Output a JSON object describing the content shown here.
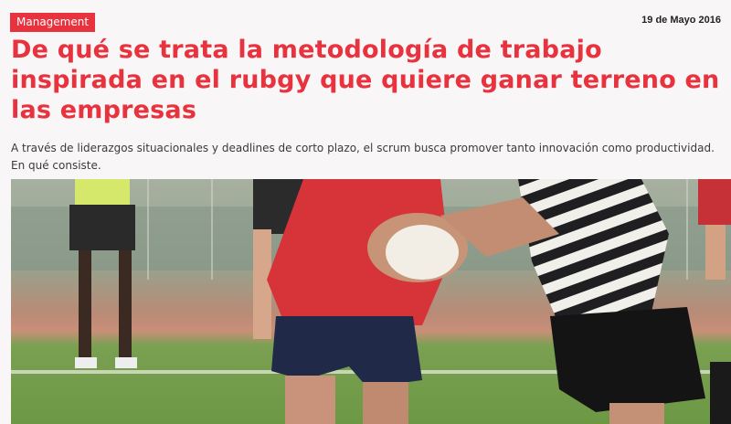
{
  "article": {
    "category": "Management",
    "date": "19 de Mayo 2016",
    "title": "De qué se trata la metodología de trabajo inspirada en el rubgy que quiere ganar terreno en las empresas",
    "summary": "A través de liderazgos situacionales y deadlines de corto plazo, el scrum busca promover tanto innovación como productividad. En qué consiste."
  },
  "colors": {
    "accent": "#e8323e",
    "background": "#f8f6f6"
  }
}
